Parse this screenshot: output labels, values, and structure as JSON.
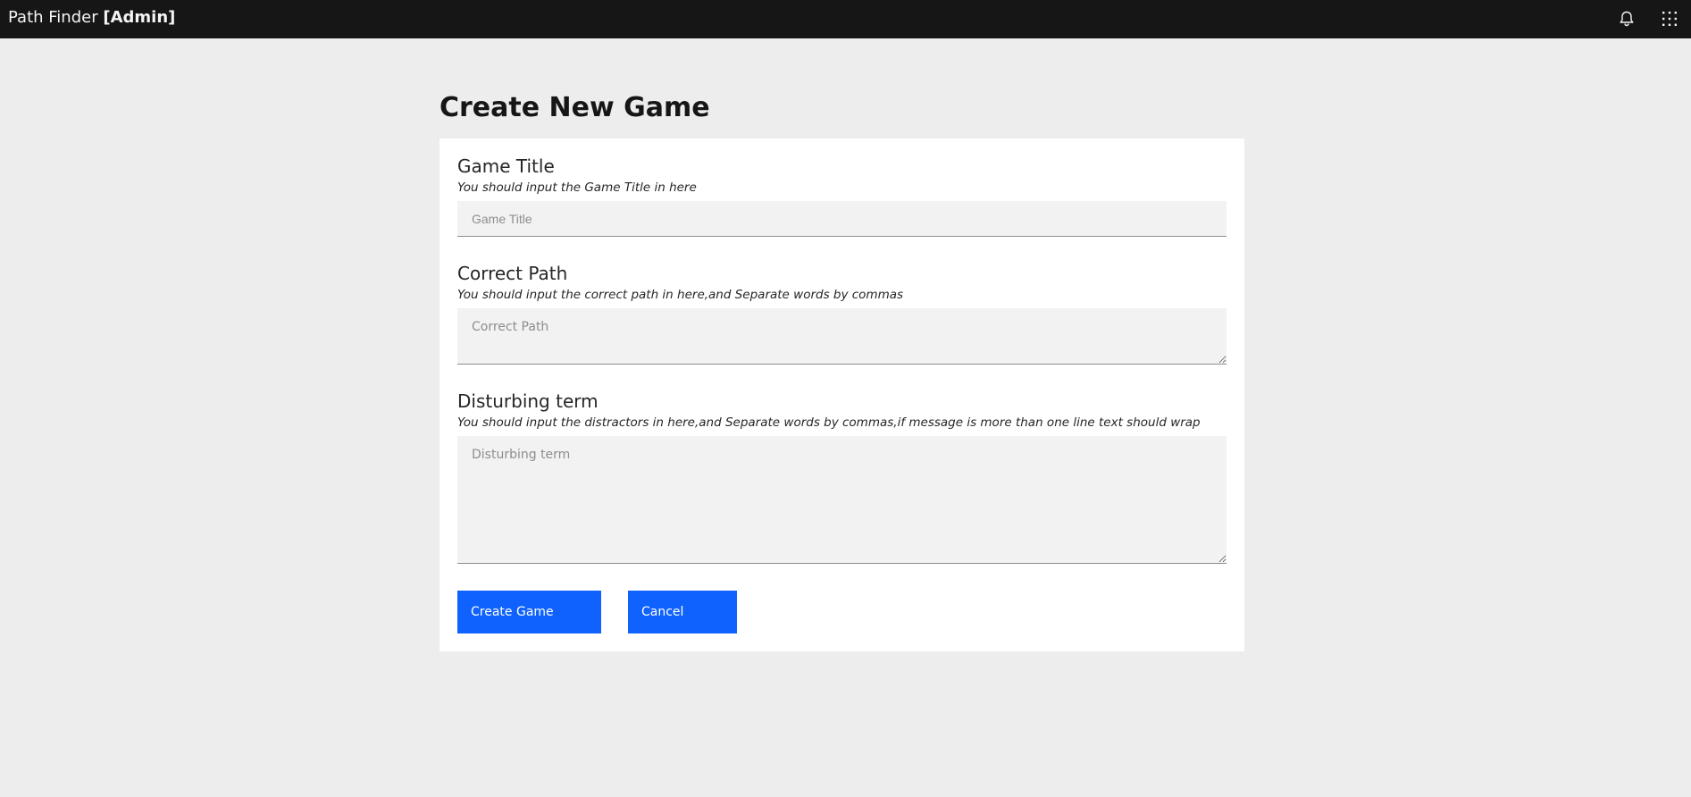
{
  "header": {
    "app_name": "Path Finder",
    "app_suffix": "[Admin]",
    "icons": [
      "notification-icon",
      "app-switcher-icon"
    ]
  },
  "page": {
    "title": "Create New Game"
  },
  "form": {
    "game_title": {
      "label": "Game Title",
      "help": "You should input the Game Title in here",
      "placeholder": "Game Title",
      "value": ""
    },
    "correct_path": {
      "label": "Correct Path",
      "help": "You should input the correct path in here,and Separate words by commas",
      "placeholder": "Correct Path",
      "value": ""
    },
    "disturbing_term": {
      "label": "Disturbing term",
      "help": "You should input the distractors in here,and Separate words by commas,if message is more than one line text should wrap",
      "placeholder": "Disturbing term",
      "value": ""
    },
    "buttons": {
      "create": "Create Game",
      "cancel": "Cancel"
    }
  },
  "colors": {
    "header_bg": "#161616",
    "page_bg": "#ededed",
    "card_bg": "#ffffff",
    "field_bg": "#f2f2f2",
    "button_primary": "#0f62fe"
  }
}
